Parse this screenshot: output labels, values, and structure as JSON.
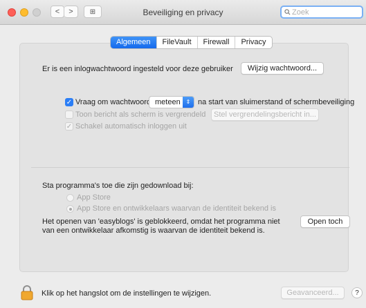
{
  "window": {
    "title": "Beveiliging en privacy",
    "back_label": "<",
    "forward_label": ">",
    "grid_label": "⊞"
  },
  "search": {
    "placeholder": "Zoek",
    "icon": "search-icon"
  },
  "tabs": [
    {
      "label": "Algemeen",
      "active": true
    },
    {
      "label": "FileVault",
      "active": false
    },
    {
      "label": "Firewall",
      "active": false
    },
    {
      "label": "Privacy",
      "active": false
    }
  ],
  "general": {
    "login_password_text": "Er is een inlogwachtwoord ingesteld voor deze gebruiker",
    "change_password_button": "Wijzig wachtwoord...",
    "require_password": {
      "checked": true,
      "label": "Vraag om wachtwoord",
      "selected_option": "meteen",
      "suffix": "na start van sluimerstand of schermbeveiliging"
    },
    "show_message": {
      "checked": false,
      "disabled": true,
      "label": "Toon bericht als scherm is vergrendeld",
      "button": "Stel vergrendelingsbericht in..."
    },
    "disable_auto_login": {
      "checked": true,
      "disabled": true,
      "label": "Schakel automatisch inloggen uit"
    }
  },
  "downloads": {
    "heading": "Sta programma's toe die zijn gedownload bij:",
    "options": [
      {
        "label": "App Store",
        "selected": false
      },
      {
        "label": "App Store en ontwikkelaars waarvan de identiteit bekend is",
        "selected": true
      }
    ],
    "blocked_line1": "Het openen van 'easyblogs' is geblokkeerd, omdat het programma niet",
    "blocked_line2": "van een ontwikkelaar afkomstig is waarvan de identiteit bekend is.",
    "open_anyway_button": "Open toch"
  },
  "footer": {
    "lock_text": "Klik op het hangslot om de instellingen te wijzigen.",
    "advanced_button": "Geavanceerd...",
    "help_label": "?"
  },
  "colors": {
    "accent": "#1a6fef",
    "close": "#fe5f57",
    "minimize": "#febc2e"
  }
}
